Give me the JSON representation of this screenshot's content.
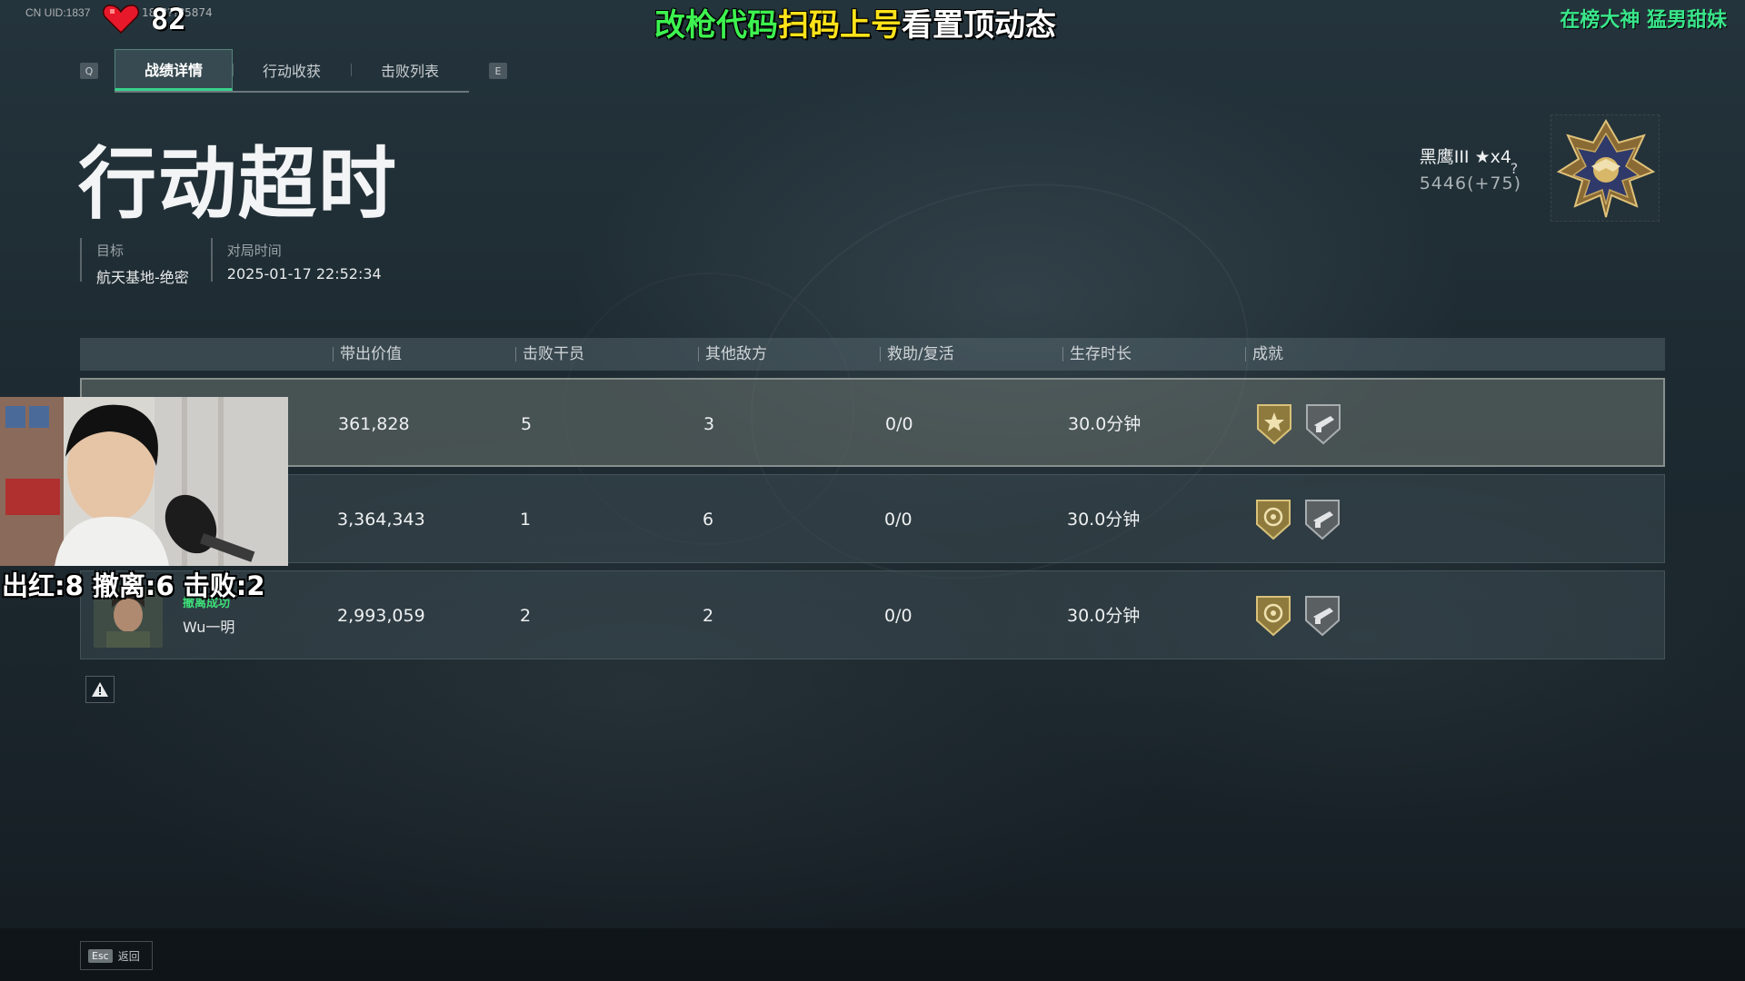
{
  "overlay": {
    "uid_prefix": "CN UID:1837",
    "uid_suffix": "18?????5874",
    "hp": "82",
    "promo_part1": "改枪代码",
    "promo_part2": "扫码上号",
    "promo_part3": "看置顶动态",
    "corner_text": "在榜大神 猛男甜妹",
    "webcam_stats": "出红:8 撤离:6 击败:2"
  },
  "tabs": {
    "prev_key": "Q",
    "next_key": "E",
    "items": [
      {
        "label": "战绩详情",
        "active": true
      },
      {
        "label": "行动收获",
        "active": false
      },
      {
        "label": "击败列表",
        "active": false
      }
    ]
  },
  "result_title": "行动超时",
  "meta": {
    "target_label": "目标",
    "target_value": "航天基地-绝密",
    "time_label": "对局时间",
    "time_value": "2025-01-17 22:52:34"
  },
  "rank": {
    "name": "黑鹰III ★x4",
    "score": "5446(+75)",
    "help": "?"
  },
  "table": {
    "headers": [
      "带出价值",
      "击败干员",
      "其他敌方",
      "救助/复活",
      "生存时长",
      "成就"
    ],
    "rows": [
      {
        "value": "361,828",
        "kills": "5",
        "others": "3",
        "assist": "0/0",
        "survival": "30.0分钟",
        "status": "",
        "player": ""
      },
      {
        "value": "3,364,343",
        "kills": "1",
        "others": "6",
        "assist": "0/0",
        "survival": "30.0分钟",
        "status": "",
        "player": ""
      },
      {
        "value": "2,993,059",
        "kills": "2",
        "others": "2",
        "assist": "0/0",
        "survival": "30.0分钟",
        "status": "撤离成功",
        "player": "Wu一明"
      }
    ]
  },
  "footer": {
    "esc_key": "Esc",
    "esc_label": "返回"
  },
  "colors": {
    "accent_green": "#38d18a",
    "promo_green": "#3df250",
    "promo_yellow": "#ffe31a",
    "status_green": "#3ee07a"
  }
}
